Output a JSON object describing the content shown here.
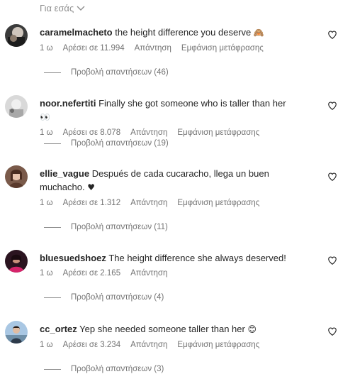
{
  "filter": {
    "label": "Για εσάς"
  },
  "comments": [
    {
      "username": "caramelmacheto",
      "text": "the height difference you deserve",
      "emoji": "🙈",
      "time": "1 ω",
      "likes": "Αρέσει σε 11.994",
      "reply": "Απάντηση",
      "translate": "Εμφάνιση μετάφρασης",
      "replies": "Προβολή απαντήσεων (46)"
    },
    {
      "username": "noor.nefertiti",
      "text": "Finally she got someone who is taller than her",
      "emoji": "👀",
      "time": "1 ω",
      "likes": "Αρέσει σε 8.078",
      "reply": "Απάντηση",
      "translate": "Εμφάνιση μετάφρασης",
      "replies": "Προβολή απαντήσεων (19)"
    },
    {
      "username": "ellie_vague",
      "text": "Después de cada cucaracho, llega un buen muchacho.",
      "emoji": "♥",
      "time": "1 ω",
      "likes": "Αρέσει σε 1.312",
      "reply": "Απάντηση",
      "translate": "Εμφάνιση μετάφρασης",
      "replies": "Προβολή απαντήσεων (11)"
    },
    {
      "username": "bluesuedshoez",
      "text": "The height difference she always deserved!",
      "emoji": "",
      "time": "1 ω",
      "likes": "Αρέσει σε 2.165",
      "reply": "Απάντηση",
      "translate": "",
      "replies": "Προβολή απαντήσεων (4)"
    },
    {
      "username": "cc_ortez",
      "text": "Yep she needed someone taller than her",
      "emoji": "😊",
      "time": "1 ω",
      "likes": "Αρέσει σε 3.234",
      "reply": "Απάντηση",
      "translate": "Εμφάνιση μετάφρασης",
      "replies": "Προβολή απαντήσεων (3)"
    }
  ],
  "icons": {
    "heart": "heart-outline-icon",
    "chevron": "chevron-down-icon"
  }
}
